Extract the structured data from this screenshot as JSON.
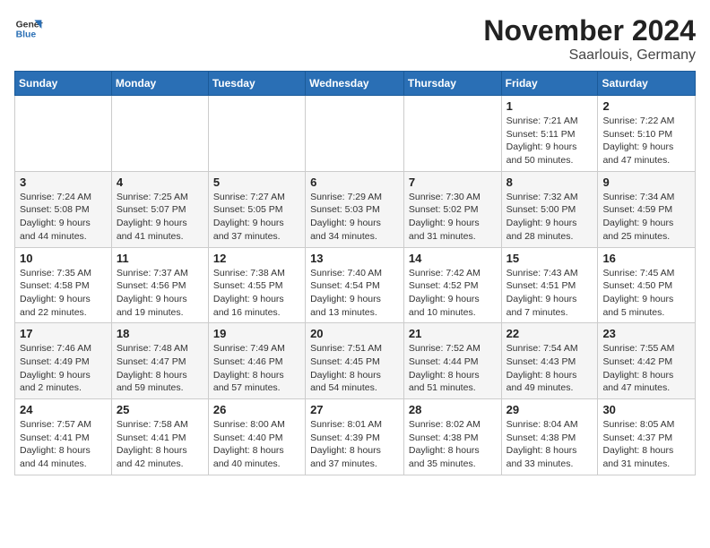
{
  "header": {
    "logo_line1": "General",
    "logo_line2": "Blue",
    "month": "November 2024",
    "location": "Saarlouis, Germany"
  },
  "days_of_week": [
    "Sunday",
    "Monday",
    "Tuesday",
    "Wednesday",
    "Thursday",
    "Friday",
    "Saturday"
  ],
  "weeks": [
    {
      "days": [
        {
          "num": "",
          "info": ""
        },
        {
          "num": "",
          "info": ""
        },
        {
          "num": "",
          "info": ""
        },
        {
          "num": "",
          "info": ""
        },
        {
          "num": "",
          "info": ""
        },
        {
          "num": "1",
          "info": "Sunrise: 7:21 AM\nSunset: 5:11 PM\nDaylight: 9 hours and 50 minutes."
        },
        {
          "num": "2",
          "info": "Sunrise: 7:22 AM\nSunset: 5:10 PM\nDaylight: 9 hours and 47 minutes."
        }
      ]
    },
    {
      "days": [
        {
          "num": "3",
          "info": "Sunrise: 7:24 AM\nSunset: 5:08 PM\nDaylight: 9 hours and 44 minutes."
        },
        {
          "num": "4",
          "info": "Sunrise: 7:25 AM\nSunset: 5:07 PM\nDaylight: 9 hours and 41 minutes."
        },
        {
          "num": "5",
          "info": "Sunrise: 7:27 AM\nSunset: 5:05 PM\nDaylight: 9 hours and 37 minutes."
        },
        {
          "num": "6",
          "info": "Sunrise: 7:29 AM\nSunset: 5:03 PM\nDaylight: 9 hours and 34 minutes."
        },
        {
          "num": "7",
          "info": "Sunrise: 7:30 AM\nSunset: 5:02 PM\nDaylight: 9 hours and 31 minutes."
        },
        {
          "num": "8",
          "info": "Sunrise: 7:32 AM\nSunset: 5:00 PM\nDaylight: 9 hours and 28 minutes."
        },
        {
          "num": "9",
          "info": "Sunrise: 7:34 AM\nSunset: 4:59 PM\nDaylight: 9 hours and 25 minutes."
        }
      ]
    },
    {
      "days": [
        {
          "num": "10",
          "info": "Sunrise: 7:35 AM\nSunset: 4:58 PM\nDaylight: 9 hours and 22 minutes."
        },
        {
          "num": "11",
          "info": "Sunrise: 7:37 AM\nSunset: 4:56 PM\nDaylight: 9 hours and 19 minutes."
        },
        {
          "num": "12",
          "info": "Sunrise: 7:38 AM\nSunset: 4:55 PM\nDaylight: 9 hours and 16 minutes."
        },
        {
          "num": "13",
          "info": "Sunrise: 7:40 AM\nSunset: 4:54 PM\nDaylight: 9 hours and 13 minutes."
        },
        {
          "num": "14",
          "info": "Sunrise: 7:42 AM\nSunset: 4:52 PM\nDaylight: 9 hours and 10 minutes."
        },
        {
          "num": "15",
          "info": "Sunrise: 7:43 AM\nSunset: 4:51 PM\nDaylight: 9 hours and 7 minutes."
        },
        {
          "num": "16",
          "info": "Sunrise: 7:45 AM\nSunset: 4:50 PM\nDaylight: 9 hours and 5 minutes."
        }
      ]
    },
    {
      "days": [
        {
          "num": "17",
          "info": "Sunrise: 7:46 AM\nSunset: 4:49 PM\nDaylight: 9 hours and 2 minutes."
        },
        {
          "num": "18",
          "info": "Sunrise: 7:48 AM\nSunset: 4:47 PM\nDaylight: 8 hours and 59 minutes."
        },
        {
          "num": "19",
          "info": "Sunrise: 7:49 AM\nSunset: 4:46 PM\nDaylight: 8 hours and 57 minutes."
        },
        {
          "num": "20",
          "info": "Sunrise: 7:51 AM\nSunset: 4:45 PM\nDaylight: 8 hours and 54 minutes."
        },
        {
          "num": "21",
          "info": "Sunrise: 7:52 AM\nSunset: 4:44 PM\nDaylight: 8 hours and 51 minutes."
        },
        {
          "num": "22",
          "info": "Sunrise: 7:54 AM\nSunset: 4:43 PM\nDaylight: 8 hours and 49 minutes."
        },
        {
          "num": "23",
          "info": "Sunrise: 7:55 AM\nSunset: 4:42 PM\nDaylight: 8 hours and 47 minutes."
        }
      ]
    },
    {
      "days": [
        {
          "num": "24",
          "info": "Sunrise: 7:57 AM\nSunset: 4:41 PM\nDaylight: 8 hours and 44 minutes."
        },
        {
          "num": "25",
          "info": "Sunrise: 7:58 AM\nSunset: 4:41 PM\nDaylight: 8 hours and 42 minutes."
        },
        {
          "num": "26",
          "info": "Sunrise: 8:00 AM\nSunset: 4:40 PM\nDaylight: 8 hours and 40 minutes."
        },
        {
          "num": "27",
          "info": "Sunrise: 8:01 AM\nSunset: 4:39 PM\nDaylight: 8 hours and 37 minutes."
        },
        {
          "num": "28",
          "info": "Sunrise: 8:02 AM\nSunset: 4:38 PM\nDaylight: 8 hours and 35 minutes."
        },
        {
          "num": "29",
          "info": "Sunrise: 8:04 AM\nSunset: 4:38 PM\nDaylight: 8 hours and 33 minutes."
        },
        {
          "num": "30",
          "info": "Sunrise: 8:05 AM\nSunset: 4:37 PM\nDaylight: 8 hours and 31 minutes."
        }
      ]
    }
  ]
}
